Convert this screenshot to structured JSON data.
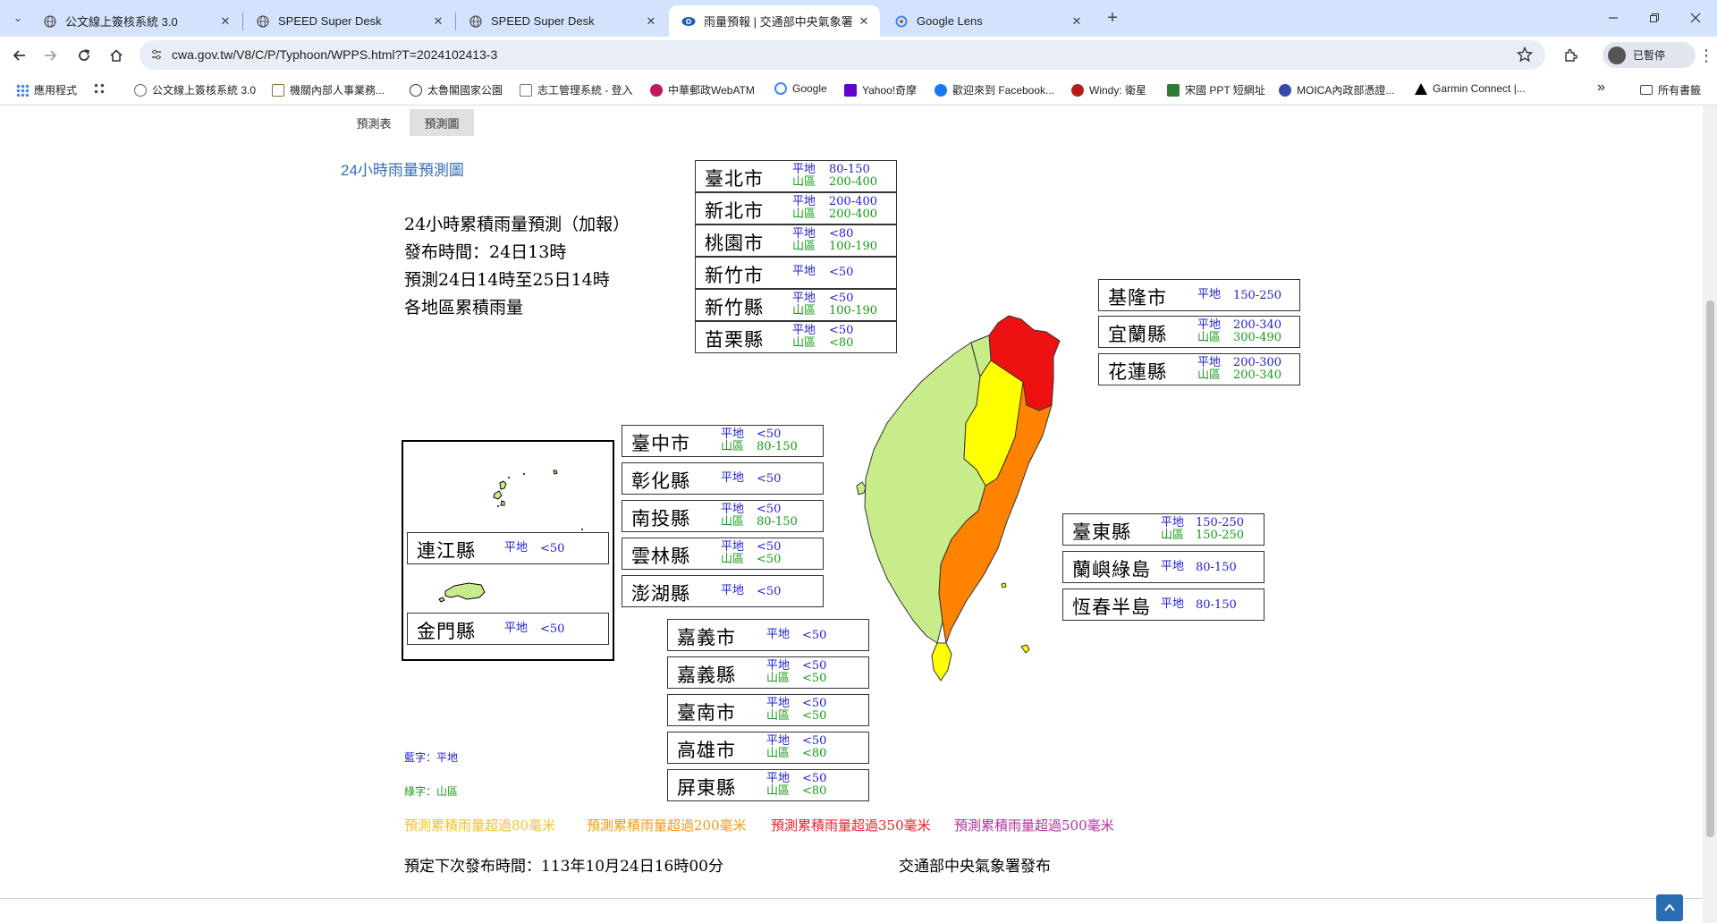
{
  "tabs": [
    {
      "title": "公文線上簽核系統 3.0",
      "close": "✕"
    },
    {
      "title": "SPEED Super Desk",
      "close": "✕"
    },
    {
      "title": "SPEED Super Desk",
      "close": "✕"
    },
    {
      "title": "雨量預報 | 交通部中央氣象署",
      "close": "✕"
    },
    {
      "title": "Google Lens",
      "close": "✕"
    }
  ],
  "new_tab": "+",
  "address": {
    "url": "cwa.gov.tw/V8/C/P/Typhoon/WPPS.html?T=2024102413-3"
  },
  "profile": {
    "label": "已暫停"
  },
  "bookmarks": [
    {
      "label": "應用程式",
      "color": "#4285f4"
    },
    {
      "label": "",
      "color": "#555"
    },
    {
      "label": "公文線上簽核系統 3.0",
      "color": "#666"
    },
    {
      "label": "機關內部人事業務...",
      "color": "#8a6d3b"
    },
    {
      "label": "太魯閣國家公園",
      "color": "#333"
    },
    {
      "label": "志工管理系統 - 登入",
      "color": "#777"
    },
    {
      "label": "中華郵政WebATM",
      "color": "#c2185b"
    },
    {
      "label": "Google",
      "color": "#4285f4"
    },
    {
      "label": "Yahoo!奇摩",
      "color": "#6001d2"
    },
    {
      "label": "歡迎來到 Facebook...",
      "color": "#1877f2"
    },
    {
      "label": "Windy: 衛星",
      "color": "#b71c1c"
    },
    {
      "label": "宋國 PPT 短網址",
      "color": "#2e7d32"
    },
    {
      "label": "MOICA內政部憑證...",
      "color": "#3949ab"
    },
    {
      "label": "Garmin Connect |...",
      "color": "#000"
    }
  ],
  "bookmarks_more": "»",
  "all_bookmarks": "所有書籤",
  "subtabs": {
    "table": "預測表",
    "map": "預測圖"
  },
  "map_title": "24小時雨量預測圖",
  "header": {
    "line1": "24小時累積雨量預測（加報）",
    "line2": "發布時間：24日13時",
    "line3": "預測24日14時至25日14時",
    "line4": "各地區累積雨量"
  },
  "label_flat": "平地",
  "label_mountain": "山區",
  "regions": {
    "taipei": {
      "name": "臺北市",
      "flat": "80-150",
      "mountain": "200-400"
    },
    "newtaipei": {
      "name": "新北市",
      "flat": "200-400",
      "mountain": "200-400"
    },
    "taoyuan": {
      "name": "桃園市",
      "flat": "<80",
      "mountain": "100-190"
    },
    "hsinchucity": {
      "name": "新竹市",
      "flat": "<50"
    },
    "hsinchucounty": {
      "name": "新竹縣",
      "flat": "<50",
      "mountain": "100-190"
    },
    "miaoli": {
      "name": "苗栗縣",
      "flat": "<50",
      "mountain": "<80"
    },
    "taichung": {
      "name": "臺中市",
      "flat": "<50",
      "mountain": "80-150"
    },
    "changhua": {
      "name": "彰化縣",
      "flat": "<50"
    },
    "nantou": {
      "name": "南投縣",
      "flat": "<50",
      "mountain": "80-150"
    },
    "yunlin": {
      "name": "雲林縣",
      "flat": "<50",
      "mountain": "<50"
    },
    "penghu": {
      "name": "澎湖縣",
      "flat": "<50"
    },
    "chiayicity": {
      "name": "嘉義市",
      "flat": "<50"
    },
    "chiayicounty": {
      "name": "嘉義縣",
      "flat": "<50",
      "mountain": "<50"
    },
    "tainan": {
      "name": "臺南市",
      "flat": "<50",
      "mountain": "<50"
    },
    "kaohsiung": {
      "name": "高雄市",
      "flat": "<50",
      "mountain": "<80"
    },
    "pingtung": {
      "name": "屏東縣",
      "flat": "<50",
      "mountain": "<80"
    },
    "keelung": {
      "name": "基隆市",
      "flat": "150-250"
    },
    "yilan": {
      "name": "宜蘭縣",
      "flat": "200-340",
      "mountain": "300-490"
    },
    "hualien": {
      "name": "花蓮縣",
      "flat": "200-300",
      "mountain": "200-340"
    },
    "taitung": {
      "name": "臺東縣",
      "flat": "150-250",
      "mountain": "150-250"
    },
    "lanyu": {
      "name": "蘭嶼綠島",
      "flat": "80-150"
    },
    "hengchun": {
      "name": "恆春半島",
      "flat": "80-150"
    },
    "lienchiang": {
      "name": "連江縣",
      "flat": "<50"
    },
    "kinmen": {
      "name": "金門縣",
      "flat": "<50"
    }
  },
  "notes": {
    "blue": "藍字：平地",
    "green": "綠字：山區"
  },
  "legend": [
    {
      "text": "預測累積雨量超過80毫米",
      "color": "#f2c12e"
    },
    {
      "text": "預測累積雨量超過200毫米",
      "color": "#f59a14"
    },
    {
      "text": "預測累積雨量超過350毫米",
      "color": "#e8202a"
    },
    {
      "text": "預測累積雨量超過500毫米",
      "color": "#b0329c"
    }
  ],
  "next_release": "預定下次發布時間：113年10月24日16時00分",
  "publisher": "交通部中央氣象署發布",
  "map_colors": {
    "light": "#c9ec8a",
    "yellow": "#ffff00",
    "orange": "#ff8200",
    "red": "#ee1111"
  }
}
